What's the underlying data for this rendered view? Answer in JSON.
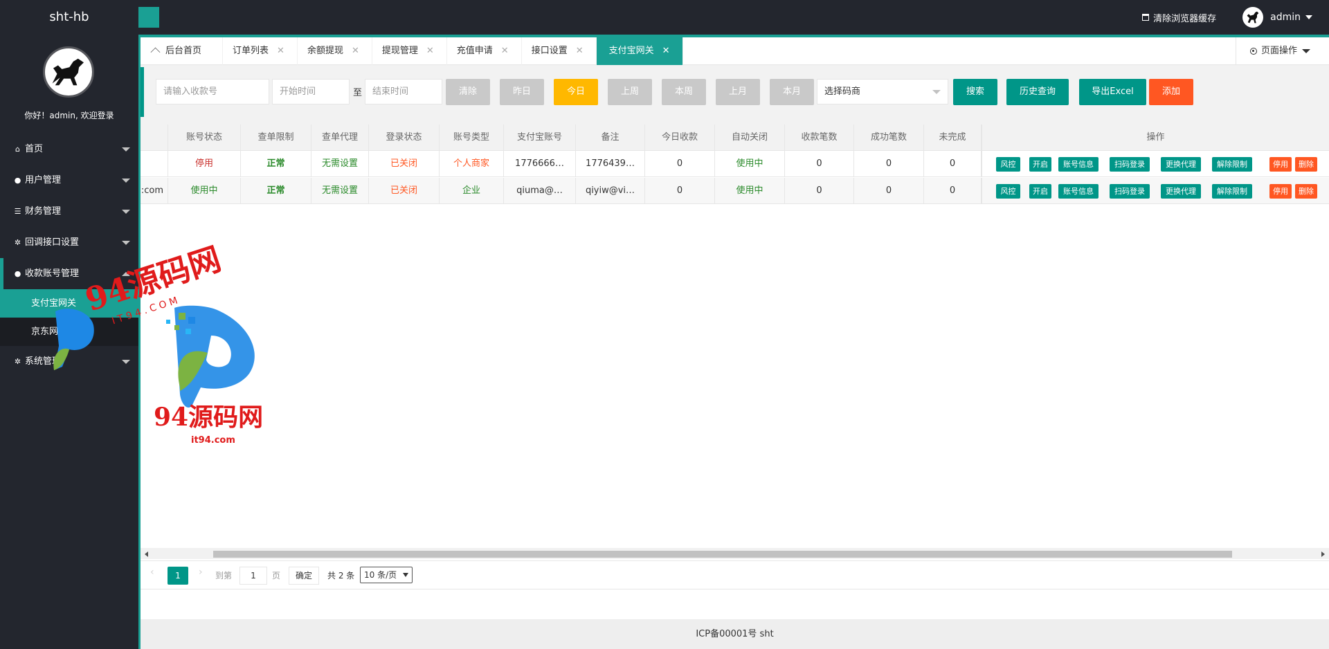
{
  "app": {
    "logo": "sht-hb"
  },
  "header": {
    "clear_cache": "清除浏览器缓存",
    "user": "admin"
  },
  "sidebar": {
    "welcome": "你好！admin, 欢迎登录",
    "items": [
      {
        "label": "首页",
        "icon": "home-icon"
      },
      {
        "label": "用户管理",
        "icon": "user-icon"
      },
      {
        "label": "财务管理",
        "icon": "list-icon"
      },
      {
        "label": "回调接口设置",
        "icon": "gear-icon"
      },
      {
        "label": "收款账号管理",
        "icon": "users-icon"
      },
      {
        "label": "系统管理",
        "icon": "gear-icon"
      }
    ],
    "sub_items": [
      {
        "label": "支付宝网关"
      },
      {
        "label": "京东网关"
      }
    ]
  },
  "tabs": [
    {
      "label": "后台首页"
    },
    {
      "label": "订单列表"
    },
    {
      "label": "余额提现"
    },
    {
      "label": "提现管理"
    },
    {
      "label": "充值申请"
    },
    {
      "label": "接口设置"
    },
    {
      "label": "支付宝网关"
    }
  ],
  "page_ops": "页面操作",
  "filter": {
    "account_placeholder": "请输入收款号",
    "start_placeholder": "开始时间",
    "to": "至",
    "end_placeholder": "结束时间",
    "clear": "清除",
    "yesterday": "昨日",
    "today": "今日",
    "last_week": "上周",
    "this_week": "本周",
    "last_month": "上月",
    "this_month": "本月",
    "merchant_select": "选择码商",
    "search": "搜索",
    "history": "历史查询",
    "export": "导出Excel",
    "add": "添加"
  },
  "table": {
    "headers": [
      "账号状态",
      "查单限制",
      "查单代理",
      "登录状态",
      "账号类型",
      "支付宝账号",
      "备注",
      "今日收款",
      "自动关闭",
      "收款笔数",
      "成功笔数",
      "未完成"
    ],
    "ops_header": "操作",
    "rows": [
      [
        "",
        "停用",
        "正常",
        "无需设置",
        "已关闭",
        "个人商家",
        "1776666…",
        "1776439…",
        "0",
        "使用中",
        "0",
        "0",
        "0"
      ],
      [
        ":com",
        "使用中",
        "正常",
        "无需设置",
        "已关闭",
        "企业",
        "qiuma@…",
        "qiyiw@vi…",
        "0",
        "使用中",
        "0",
        "0",
        "0"
      ]
    ],
    "ops": [
      "风控",
      "开启",
      "账号信息",
      "扫码登录",
      "更换代理",
      "解除限制",
      "停用",
      "删除"
    ]
  },
  "pager": {
    "current": "1",
    "goto": "到第",
    "page_input": "1",
    "page_unit": "页",
    "confirm": "确定",
    "total": "共 2 条",
    "page_size": "10 条/页"
  },
  "footer": "ICP备00001号 sht",
  "watermark": {
    "brand": "94源码网",
    "sub": "I T 9 4 . C O M",
    "domain": "it94.com"
  },
  "colors": {
    "accent": "#009688",
    "sidebar": "#23262e",
    "warning": "#ffb800",
    "danger": "#ff5722"
  }
}
